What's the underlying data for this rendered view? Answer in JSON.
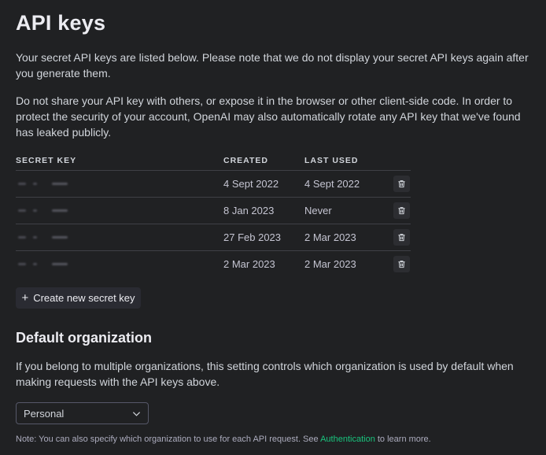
{
  "page": {
    "title": "API keys",
    "intro_1": "Your secret API keys are listed below. Please note that we do not display your secret API keys again after you generate them.",
    "intro_2": "Do not share your API key with others, or expose it in the browser or other client-side code. In order to protect the security of your account, OpenAI may also automatically rotate any API key that we've found has leaked publicly."
  },
  "keys_table": {
    "headers": {
      "secret_key": "SECRET KEY",
      "created": "CREATED",
      "last_used": "LAST USED"
    },
    "rows": [
      {
        "created": "4 Sept 2022",
        "last_used": "4 Sept 2022"
      },
      {
        "created": "8 Jan 2023",
        "last_used": "Never"
      },
      {
        "created": "27 Feb 2023",
        "last_used": "2 Mar 2023"
      },
      {
        "created": "2 Mar 2023",
        "last_used": "2 Mar 2023"
      }
    ]
  },
  "create_button": {
    "label": "Create new secret key",
    "icon": "plus-icon"
  },
  "default_org": {
    "heading": "Default organization",
    "description": "If you belong to multiple organizations, this setting controls which organization is used by default when making requests with the API keys above.",
    "selected": "Personal"
  },
  "note": {
    "prefix": "Note: You can also specify which organization to use for each API request. See ",
    "link": "Authentication",
    "suffix": " to learn more."
  },
  "colors": {
    "accent": "#19c37d",
    "background": "#202123"
  },
  "icons": {
    "delete": "trash-icon",
    "dropdown": "chevron-down-icon"
  }
}
